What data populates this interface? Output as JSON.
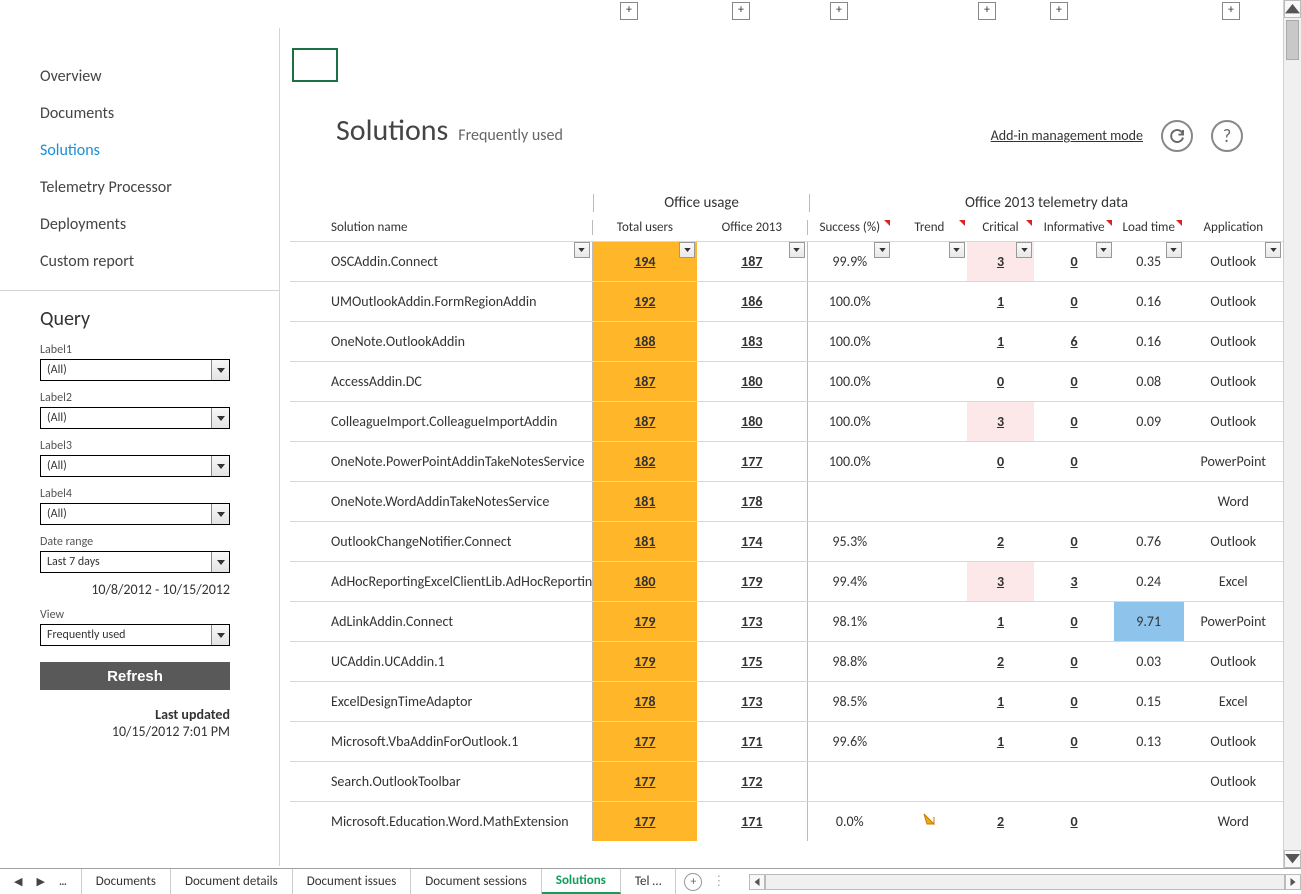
{
  "collapse_positions": [
    620,
    732,
    830,
    978,
    1050,
    1222
  ],
  "nav": {
    "items": [
      {
        "label": "Overview",
        "active": false
      },
      {
        "label": "Documents",
        "active": false
      },
      {
        "label": "Solutions",
        "active": true
      },
      {
        "label": "Telemetry Processor",
        "active": false
      },
      {
        "label": "Deployments",
        "active": false
      },
      {
        "label": "Custom report",
        "active": false
      }
    ]
  },
  "query": {
    "title": "Query",
    "labels": [
      "Label1",
      "Label2",
      "Label3",
      "Label4"
    ],
    "all_text": "(All)",
    "date_range_label": "Date range",
    "date_range_value": "Last 7 days",
    "date_range_text": "10/8/2012 - 10/15/2012",
    "view_label": "View",
    "view_value": "Frequently used",
    "refresh_label": "Refresh",
    "last_updated_label": "Last updated",
    "last_updated_time": "10/15/2012 7:01 PM"
  },
  "header": {
    "title": "Solutions",
    "subtitle": "Frequently used",
    "mode_link": "Add-in management mode"
  },
  "table": {
    "group_usage": "Office usage",
    "group_telemetry": "Office 2013 telemetry data",
    "cols": {
      "solname": "Solution name",
      "totusers": "Total users",
      "off2013": "Office 2013",
      "success": "Success (%)",
      "trend": "Trend",
      "critical": "Critical",
      "informative": "Informative",
      "load": "Load time",
      "app": "Application"
    },
    "rows": [
      {
        "solname": "OSCAddin.Connect",
        "totusers": "194",
        "off2013": "187",
        "success": "99.9%",
        "trend": "",
        "critical": "3",
        "critical_pale": true,
        "informative": "0",
        "load": "0.35",
        "app": "Outlook"
      },
      {
        "solname": "UMOutlookAddin.FormRegionAddin",
        "totusers": "192",
        "off2013": "186",
        "success": "100.0%",
        "trend": "",
        "critical": "1",
        "informative": "0",
        "load": "0.16",
        "app": "Outlook"
      },
      {
        "solname": "OneNote.OutlookAddin",
        "totusers": "188",
        "off2013": "183",
        "success": "100.0%",
        "trend": "",
        "critical": "1",
        "informative": "6",
        "load": "0.16",
        "app": "Outlook"
      },
      {
        "solname": "AccessAddin.DC",
        "totusers": "187",
        "off2013": "180",
        "success": "100.0%",
        "trend": "",
        "critical": "0",
        "informative": "0",
        "load": "0.08",
        "app": "Outlook"
      },
      {
        "solname": "ColleagueImport.ColleagueImportAddin",
        "totusers": "187",
        "off2013": "180",
        "success": "100.0%",
        "trend": "",
        "critical": "3",
        "critical_pale": true,
        "informative": "0",
        "load": "0.09",
        "app": "Outlook"
      },
      {
        "solname": "OneNote.PowerPointAddinTakeNotesService",
        "totusers": "182",
        "off2013": "177",
        "success": "100.0%",
        "trend": "",
        "critical": "0",
        "informative": "0",
        "load": "",
        "app": "PowerPoint"
      },
      {
        "solname": "OneNote.WordAddinTakeNotesService",
        "totusers": "181",
        "off2013": "178",
        "success": "",
        "trend": "",
        "critical": "",
        "informative": "",
        "load": "",
        "app": "Word"
      },
      {
        "solname": "OutlookChangeNotifier.Connect",
        "totusers": "181",
        "off2013": "174",
        "success": "95.3%",
        "trend": "",
        "critical": "2",
        "informative": "0",
        "load": "0.76",
        "app": "Outlook"
      },
      {
        "solname": "AdHocReportingExcelClientLib.AdHocReporting",
        "totusers": "180",
        "off2013": "179",
        "success": "99.4%",
        "trend": "",
        "critical": "3",
        "critical_pale": true,
        "informative": "3",
        "load": "0.24",
        "app": "Excel"
      },
      {
        "solname": "AdLinkAddin.Connect",
        "totusers": "179",
        "off2013": "173",
        "success": "98.1%",
        "trend": "",
        "critical": "1",
        "informative": "0",
        "load": "9.71",
        "load_highlight": true,
        "app": "PowerPoint"
      },
      {
        "solname": "UCAddin.UCAddin.1",
        "totusers": "179",
        "off2013": "175",
        "success": "98.8%",
        "trend": "",
        "critical": "2",
        "informative": "0",
        "load": "0.03",
        "app": "Outlook"
      },
      {
        "solname": "ExcelDesignTimeAdaptor",
        "totusers": "178",
        "off2013": "173",
        "success": "98.5%",
        "trend": "",
        "critical": "1",
        "informative": "0",
        "load": "0.15",
        "app": "Excel"
      },
      {
        "solname": "Microsoft.VbaAddinForOutlook.1",
        "totusers": "177",
        "off2013": "171",
        "success": "99.6%",
        "trend": "",
        "critical": "1",
        "informative": "0",
        "load": "0.13",
        "app": "Outlook"
      },
      {
        "solname": "Search.OutlookToolbar",
        "totusers": "177",
        "off2013": "172",
        "success": "",
        "trend": "",
        "critical": "",
        "informative": "",
        "load": "",
        "app": "Outlook"
      },
      {
        "solname": "Microsoft.Education.Word.MathExtension",
        "totusers": "177",
        "off2013": "171",
        "success": "0.0%",
        "trend": "down",
        "critical": "2",
        "informative": "0",
        "load": "",
        "app": "Word"
      }
    ]
  },
  "sheets": {
    "tabs": [
      "Documents",
      "Document details",
      "Document issues",
      "Document sessions",
      "Solutions",
      "Tel …"
    ],
    "active_index": 4
  }
}
